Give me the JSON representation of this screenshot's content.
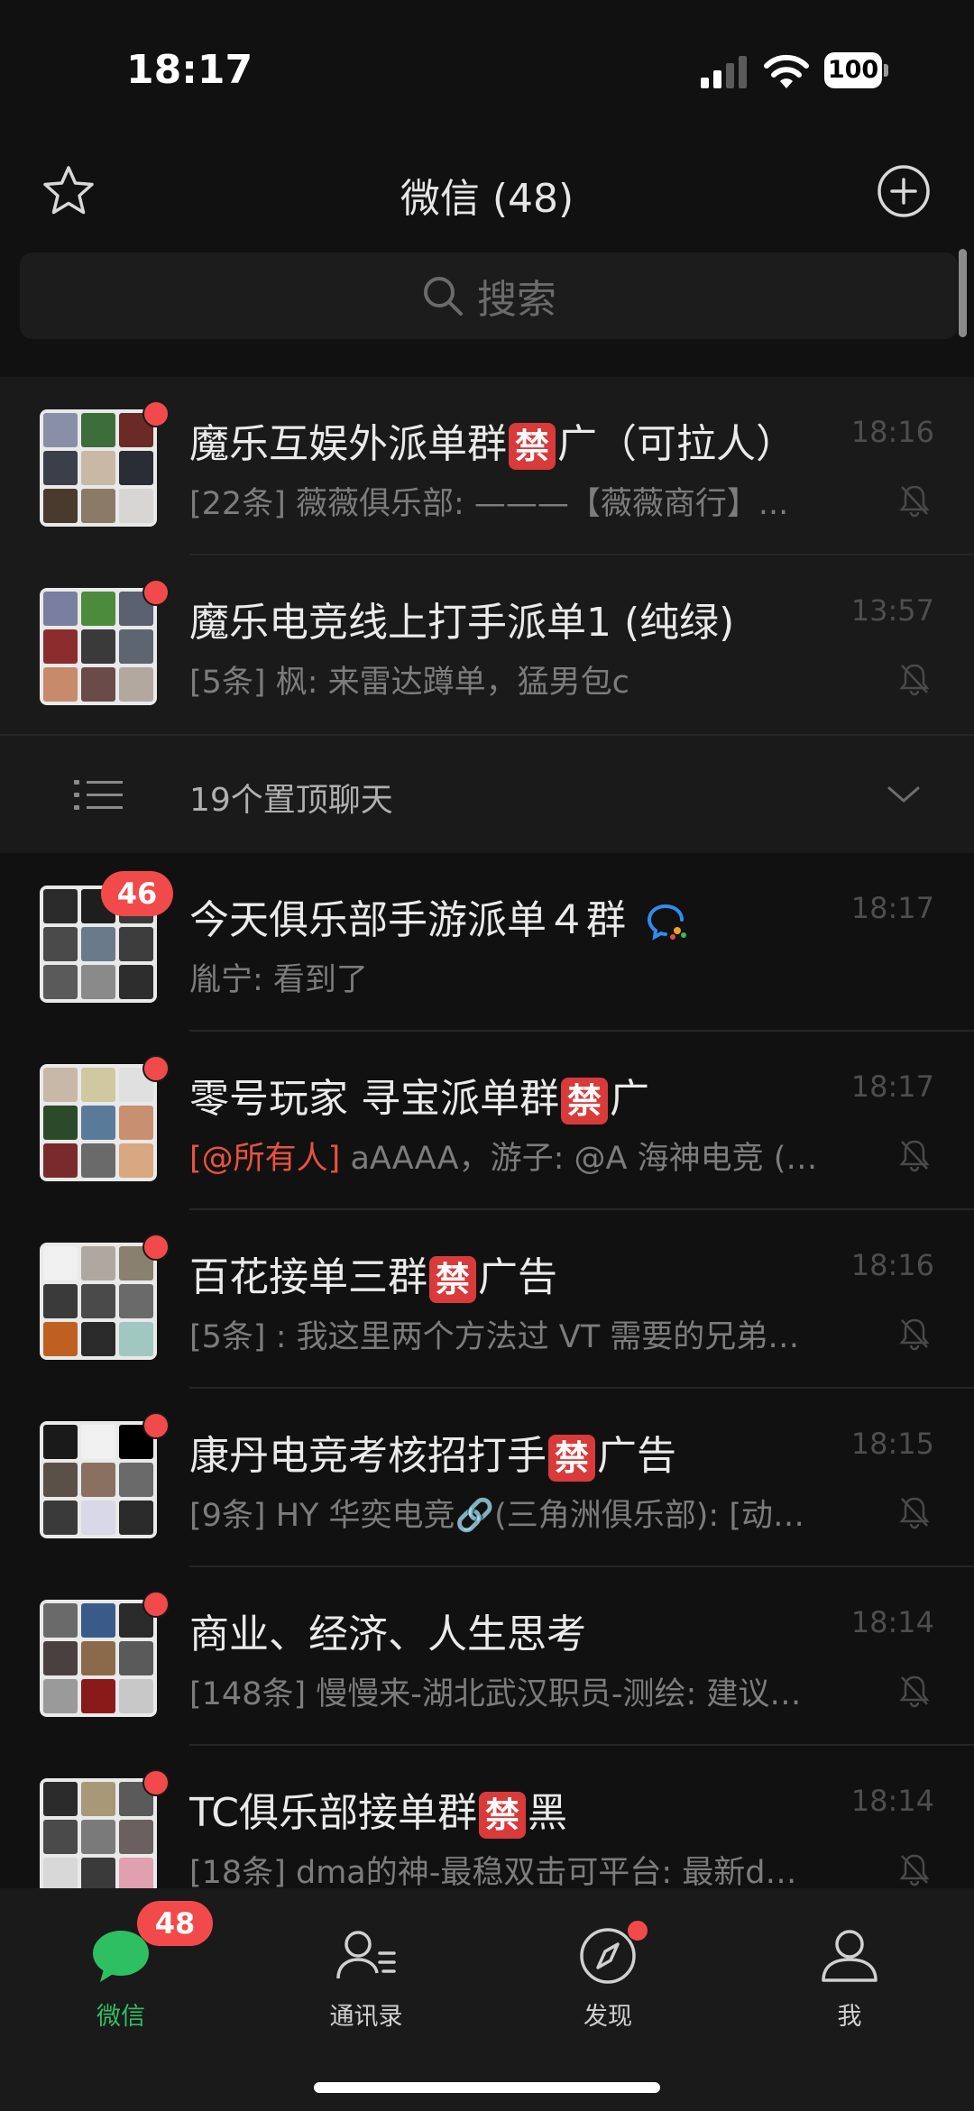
{
  "status_bar": {
    "time": "18:17",
    "battery": "100"
  },
  "header": {
    "title": "微信 (48)"
  },
  "search": {
    "placeholder": "搜索"
  },
  "pinned_chats": [
    {
      "title": "魔乐互娱外派单群",
      "ban": "禁",
      "title_suffix": "广（可拉人）",
      "preview": "[22条] 薇薇俱乐部: ———【薇薇商行】...",
      "time": "18:16",
      "muted": true
    },
    {
      "title": "魔乐电竞线上打手派单1 (纯绿)",
      "ban": "",
      "title_suffix": "",
      "preview": "[5条] 枫: 来雷达蹲单，猛男包c",
      "time": "13:57",
      "muted": true
    }
  ],
  "folded": {
    "label": "19个置顶聊天"
  },
  "chats": [
    {
      "title": "今天俱乐部手游派单４群",
      "ban": "",
      "title_suffix": "",
      "preview": "胤宁: 看到了",
      "time": "18:17",
      "unread": "46",
      "muted": false
    },
    {
      "title": "零号玩家 寻宝派单群",
      "ban": "禁",
      "title_suffix": "广",
      "mention": "[@所有人]",
      "preview": " aAAAA，游子: @A 海神电竞 (…",
      "time": "18:17",
      "muted": true
    },
    {
      "title": "百花接单三群",
      "ban": "禁",
      "title_suffix": "广告",
      "preview": "[5条] : 我这里两个方法过 VT 需要的兄弟…",
      "time": "18:16",
      "muted": true
    },
    {
      "title": "康丹电竞考核招打手",
      "ban": "禁",
      "title_suffix": "广告",
      "preview": "[9条] HY 华奕电竞🔗(三角洲俱乐部): [动…",
      "time": "18:15",
      "muted": true
    },
    {
      "title": "商业、经济、人生思考",
      "ban": "",
      "title_suffix": "",
      "preview": "[148条] 慢慢来-湖北武汉职员-测绘: 建议…",
      "time": "18:14",
      "muted": true
    },
    {
      "title": "TC俱乐部接单群",
      "ban": "禁",
      "title_suffix": "黑",
      "preview": "[18条] dma的神-最稳双击可平台: 最新d…",
      "time": "18:14",
      "muted": true
    }
  ],
  "tabbar": {
    "wechat": {
      "label": "微信",
      "badge": "48"
    },
    "contacts": {
      "label": "通讯录"
    },
    "discover": {
      "label": "发现"
    },
    "me": {
      "label": "我"
    }
  },
  "colors": {
    "accent": "#2fbf63",
    "badge": "#f24a4a",
    "mention": "#e8523f",
    "background": "#111111"
  }
}
